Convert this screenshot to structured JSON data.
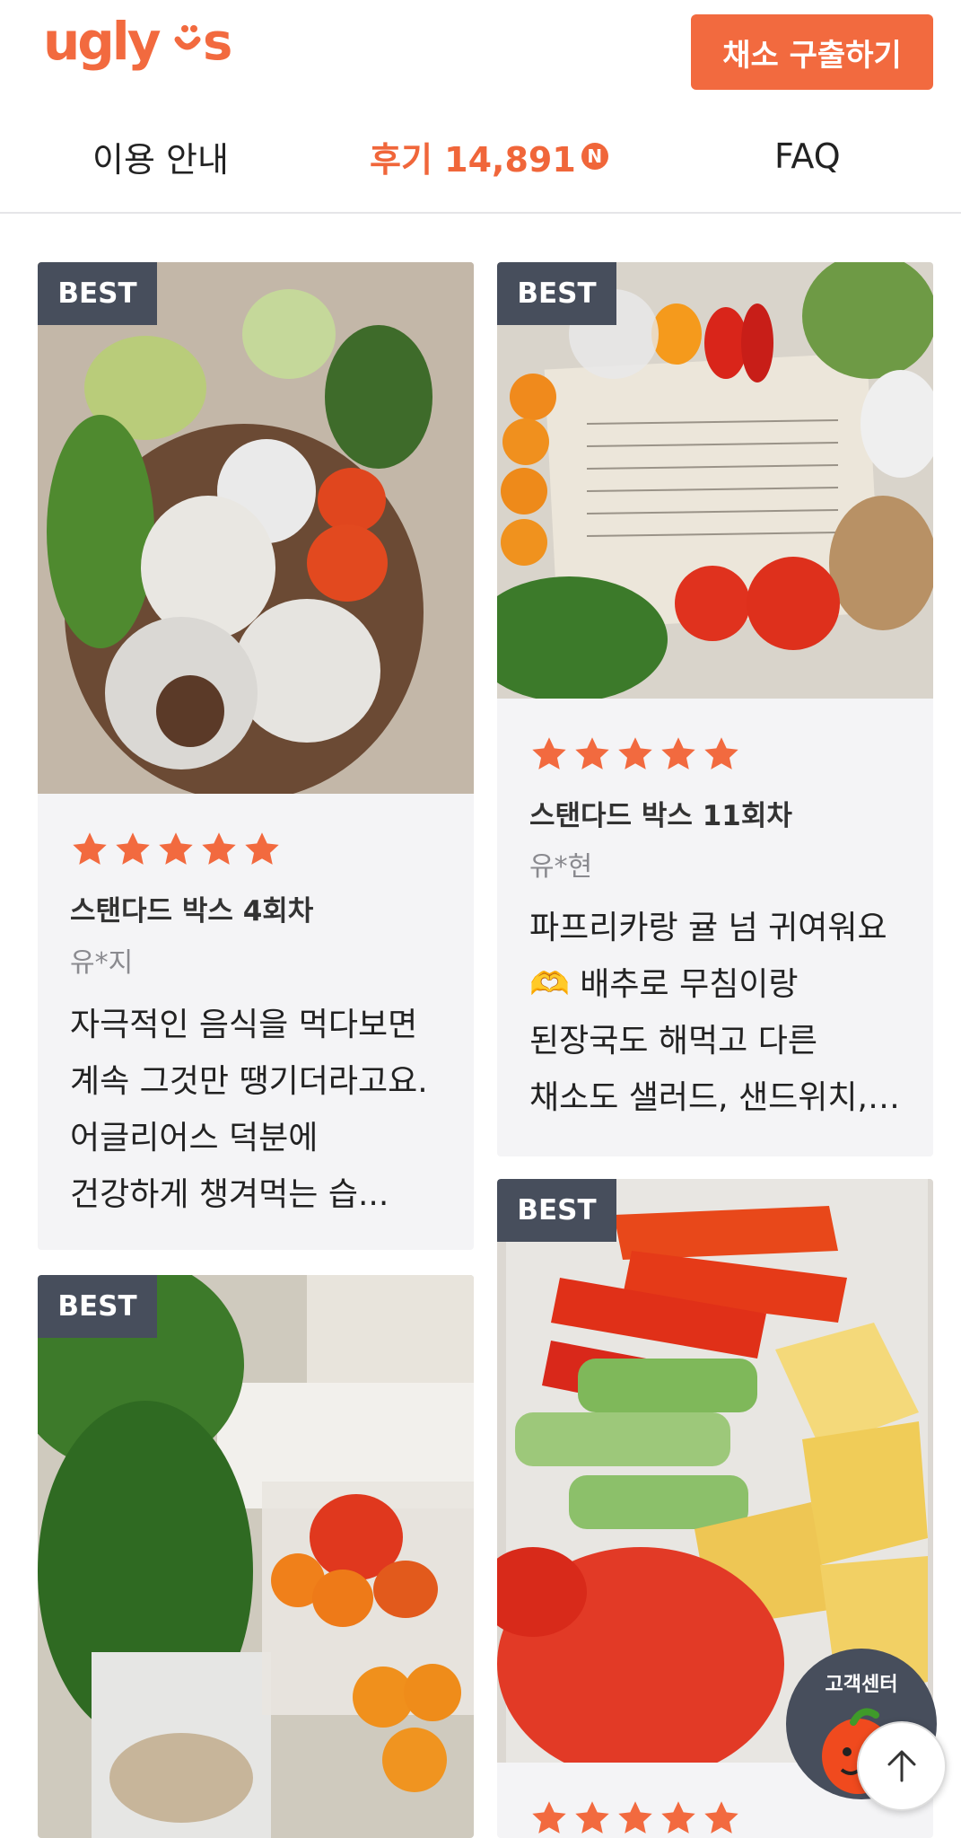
{
  "header": {
    "logo_text": "ugly us",
    "cta_label": "채소 구출하기"
  },
  "tabs": [
    {
      "label": "이용 안내"
    },
    {
      "label": "후기 14,891",
      "badge": "N",
      "active": true
    },
    {
      "label": "FAQ"
    }
  ],
  "colors": {
    "accent": "#f26a3f",
    "badge_bg": "#474e5c",
    "card_bg": "#f4f4f6"
  },
  "reviews": [
    {
      "badge": "BEST",
      "rating": 5,
      "title": "스탠다드 박스 4회차",
      "user": "유*지",
      "body": "자극적인 음식을 먹다보면 계속 그것만 땡기더라고요. 어글리어스 덕분에 건강하게 챙겨먹는 습..."
    },
    {
      "badge": "BEST",
      "rating": 5,
      "title": "스탠다드 박스 11회차",
      "user": "유*현",
      "body": "파프리카랑 귤 넘 귀여워요🫶 배추로 무침이랑 된장국도 해먹고 다른 채소도 샐러드, 샌드위치, 반..."
    },
    {
      "badge": "BEST"
    },
    {
      "badge": "BEST",
      "rating": 5
    }
  ],
  "help": {
    "label": "고객센터"
  },
  "icons": {
    "star": "star-icon",
    "arrow_up": "arrow-up-icon",
    "tomato": "tomato-mascot-icon"
  }
}
